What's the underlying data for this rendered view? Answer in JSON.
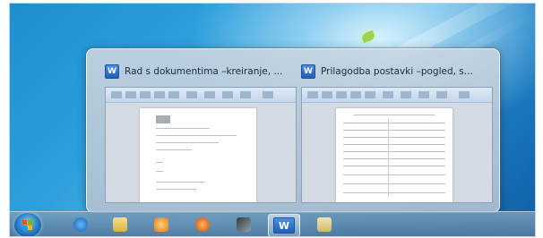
{
  "thumbnail_preview": {
    "windows": [
      {
        "title": "Rad s dokumentima –kreiranje, ...",
        "app_icon": "word-icon"
      },
      {
        "title": "Prilagodba postavki –pogled, s...",
        "app_icon": "word-icon"
      }
    ]
  },
  "taskbar": {
    "start_icon": "windows-start-orb",
    "pinned": [
      {
        "icon": "internet-explorer-icon"
      },
      {
        "icon": "file-explorer-icon"
      },
      {
        "icon": "media-player-icon"
      },
      {
        "icon": "firefox-icon"
      },
      {
        "icon": "app-icon"
      },
      {
        "icon": "word-icon",
        "label": "W",
        "active": true
      },
      {
        "icon": "folder-icon"
      }
    ]
  },
  "colors": {
    "desktop": "#2d9fdc",
    "taskbar": "#5f8bb0",
    "word_blue": "#1f5fb8"
  }
}
